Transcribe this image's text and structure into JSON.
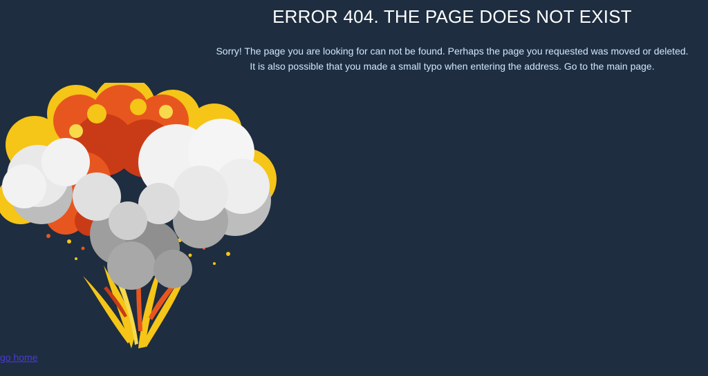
{
  "header": {
    "title": "ERROR 404. THE PAGE DOES NOT EXIST"
  },
  "main": {
    "message": "Sorry! The page you are looking for can not be found. Perhaps the page you requested was moved or deleted. It is also possible that you made a small typo when entering the address. Go to the main page."
  },
  "footer": {
    "home_link_label": "go home"
  },
  "colors": {
    "background": "#1e2d40",
    "title": "#ffffff",
    "message": "#cfe7ff",
    "link": "#4b3bd6",
    "explosion_orange": "#e8561f",
    "explosion_red": "#c93b16",
    "explosion_yellow": "#f5c518",
    "smoke_white": "#f2f2f2",
    "smoke_gray": "#bdbdbd",
    "smoke_dark": "#8f8f8f"
  },
  "illustration": {
    "icon": "explosion-illustration"
  }
}
